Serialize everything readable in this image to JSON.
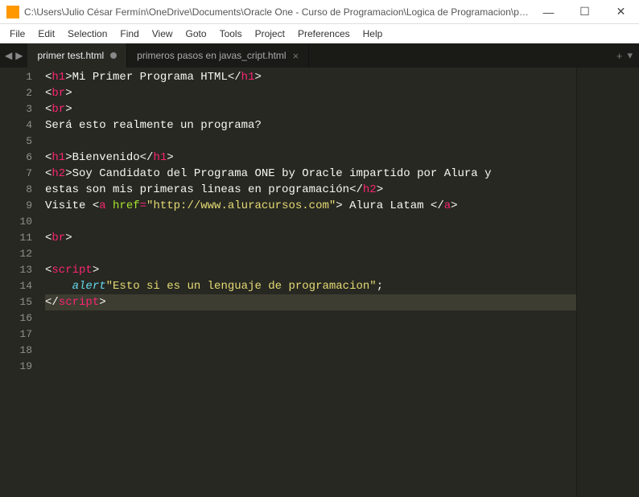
{
  "titlebar": {
    "title": "C:\\Users\\Julio César Fermín\\OneDrive\\Documents\\Oracle One - Curso de Programacion\\Logica de Programacion\\pri…",
    "minimize": "—",
    "maximize": "☐",
    "close": "✕"
  },
  "menu": {
    "file": "File",
    "edit": "Edit",
    "selection": "Selection",
    "find": "Find",
    "view": "View",
    "goto": "Goto",
    "tools": "Tools",
    "project": "Project",
    "preferences": "Preferences",
    "help": "Help"
  },
  "tabbar": {
    "nav_left": "◀",
    "nav_right": "▶",
    "plus": "+",
    "dropdown": "▾"
  },
  "tabs": [
    {
      "label": "primer test.html",
      "active": true,
      "dirty": true
    },
    {
      "label": "primeros pasos en javas_cript.html",
      "active": false,
      "dirty": false
    }
  ],
  "line_numbers": [
    "1",
    "2",
    "3",
    "4",
    "5",
    "6",
    "7",
    "8",
    "9",
    "10",
    "11",
    "12",
    "13",
    "14",
    "15",
    "16",
    "17",
    "18",
    "19"
  ],
  "code": {
    "h1_open": "h1",
    "h1_close": "h1",
    "l1_text": "Mi Primer Programa HTML",
    "br": "br",
    "l4_text": "Será esto realmente un programa?",
    "l6_text": "Bienvenido",
    "h2_open": "h2",
    "h2_close": "h2",
    "l7a": "Soy Candidato del Programa ONE by Oracle impartido por Alura y ",
    "l7b": "estas son mis primeras lineas en programación",
    "l9a": "Visite ",
    "a_tag": "a",
    "href_attr": "href",
    "href_val": "\"http://www.aluracursos.com\"",
    "l9b": " Alura Latam ",
    "script_tag": "script",
    "alert_fn": "alert",
    "alert_str": "\"Esto si es un lenguaje de programacion\""
  }
}
